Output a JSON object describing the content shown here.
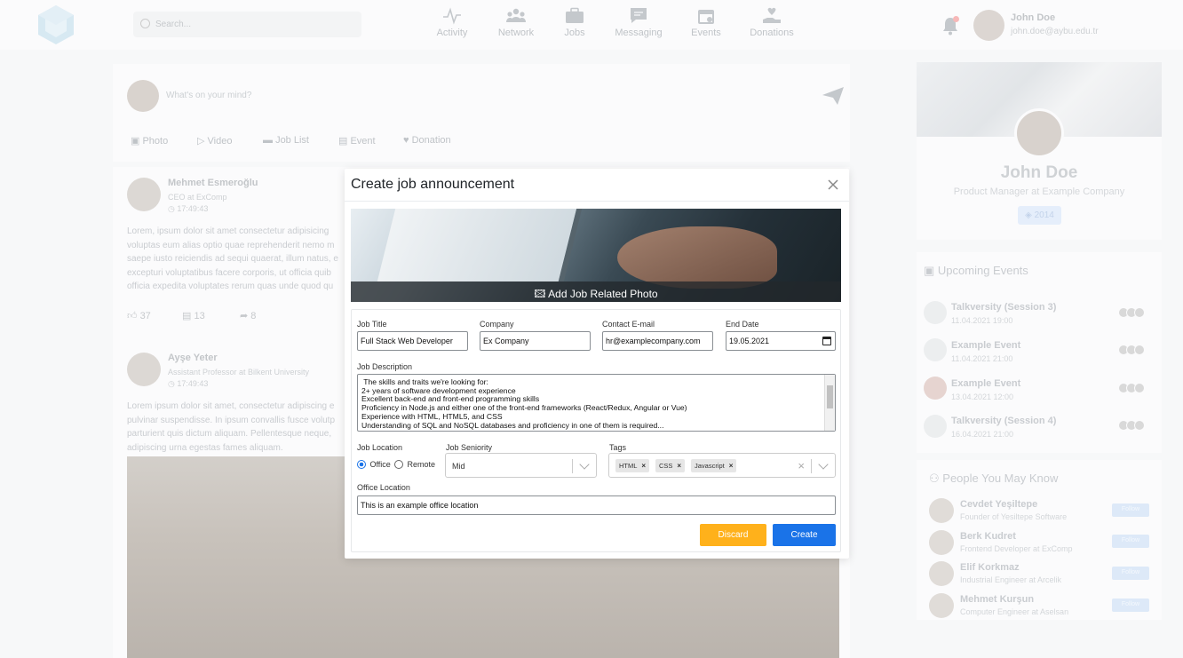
{
  "topnav": {
    "search_placeholder": "Search...",
    "items": [
      {
        "label": "Activity",
        "icon": "activity-icon"
      },
      {
        "label": "Network",
        "icon": "network-icon"
      },
      {
        "label": "Jobs",
        "icon": "briefcase-icon"
      },
      {
        "label": "Messaging",
        "icon": "message-icon"
      },
      {
        "label": "Events",
        "icon": "calendar-icon"
      },
      {
        "label": "Donations",
        "icon": "donation-icon"
      }
    ],
    "user_name": "John Doe",
    "user_email": "john.doe@aybu.edu.tr"
  },
  "postbox": {
    "placeholder": "What's on your mind?",
    "actions": [
      "Photo",
      "Video",
      "Job List",
      "Event",
      "Donation"
    ]
  },
  "feed": {
    "posts": [
      {
        "author": "Mehmet Esmeroğlu",
        "subtitle": "CEO at ExComp",
        "time": "17:49:43",
        "lines": [
          "Lorem, ipsum dolor sit amet consectetur adipisicing",
          "voluptas eum alias optio quae reprehenderit nemo m",
          "saepe iusto reiciendis ad sequi quaerat, illum natus, e",
          "excepturi voluptatibus facere corporis, ut officia quib",
          "officia expedita voluptates rerum quas unde quod qu"
        ],
        "likes": "37",
        "comments": "13",
        "shares": "8"
      },
      {
        "author": "Ayşe Yeter",
        "subtitle": "Assistant Professor at Bilkent University",
        "time": "17:49:43",
        "lines": [
          "Lorem ipsum dolor sit amet, consectetur adipiscing e",
          "pulvinar suspendisse. In ipsum convallis fusce volutp",
          "parturient quis dictum aliquam. Pellentesque neque,",
          "adipiscing urna egestas fames aliquam."
        ]
      }
    ]
  },
  "profile": {
    "name": "John Doe",
    "title": "Product Manager at Example Company",
    "badge": "2014"
  },
  "events": {
    "heading": "Upcoming Events",
    "items": [
      {
        "name": "Talkversity (Session 3)",
        "date": "11.04.2021 19:00"
      },
      {
        "name": "Example Event",
        "date": "11.04.2021 21:00"
      },
      {
        "name": "Example Event",
        "date": "13.04.2021 12:00"
      },
      {
        "name": "Talkversity (Session 4)",
        "date": "16.04.2021 21:00"
      }
    ]
  },
  "people": {
    "heading": "People You May Know",
    "follow_label": "Follow",
    "items": [
      {
        "name": "Cevdet Yeşiltepe",
        "title": "Founder of Yesiltepe Software"
      },
      {
        "name": "Berk Kudret",
        "title": "Frontend Developer at ExComp"
      },
      {
        "name": "Elif Korkmaz",
        "title": "Industrial Engineer at Arcelik"
      },
      {
        "name": "Mehmet Kurşun",
        "title": "Computer Engineer at Aselsan"
      }
    ]
  },
  "modal": {
    "title": "Create job announcement",
    "add_photo_label": "Add Job Related Photo",
    "job_title_label": "Job Title",
    "job_title_value": "Full Stack Web Developer",
    "company_label": "Company",
    "company_value": "Ex Company",
    "contact_label": "Contact E-mail",
    "contact_value": "hr@examplecompany.com",
    "end_date_label": "End Date",
    "end_date_value": "19.05.2021",
    "description_label": "Job Description",
    "description_lines": [
      " The skills and traits we're looking for:",
      "2+ years of software development experience",
      "Excellent back-end and front-end programming skills",
      "Proficiency in Node.js and either one of the front-end frameworks (React/Redux, Angular or Vue)",
      "Experience with HTML, HTML5, and CSS",
      "Understanding of SQL and NoSQL databases and proficiency in one of them is required..."
    ],
    "location_label": "Job Location",
    "location_options": [
      "Office",
      "Remote"
    ],
    "location_selected": "Office",
    "seniority_label": "Job Seniority",
    "seniority_value": "Mid",
    "tags_label": "Tags",
    "tags": [
      "HTML",
      "CSS",
      "Javascript"
    ],
    "office_location_label": "Office Location",
    "office_location_value": "This is an example office location",
    "discard_label": "Discard",
    "create_label": "Create",
    "colors": {
      "discard": "#ffb11b",
      "create": "#1a73e8"
    }
  }
}
